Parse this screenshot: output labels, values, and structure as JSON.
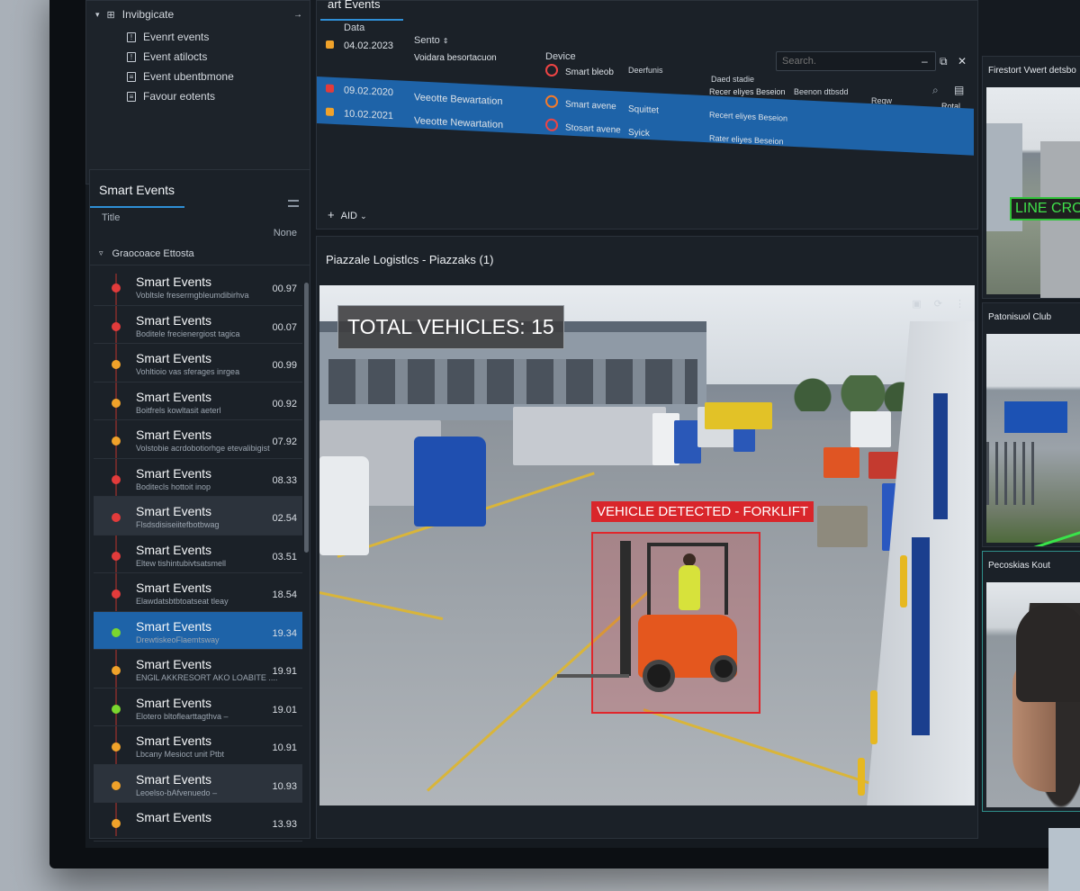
{
  "nav": {
    "header": "Invibgicate",
    "items": [
      "Evenrt events",
      "Event atilocts",
      "Event ubentbmone",
      "Favour eotents"
    ]
  },
  "events_panel": {
    "title": "Smart Events",
    "col_title": "Title",
    "col_none": "None",
    "group": "Graocoace Ettosta",
    "items": [
      {
        "name": "Smart Events",
        "sub": "Vobltsle fresermgbleumdibirhva",
        "time": "00.97",
        "color": "#e23b3b",
        "state": ""
      },
      {
        "name": "Smart Events",
        "sub": "Boditele frecienergiost tagica",
        "time": "00.07",
        "color": "#e23b3b",
        "state": ""
      },
      {
        "name": "Smart Events",
        "sub": "Vohltioio vas sferages inrgea",
        "time": "00.99",
        "color": "#f0a22a",
        "state": ""
      },
      {
        "name": "Smart Events",
        "sub": "Boitfrels kowltasit aeterl",
        "time": "00.92",
        "color": "#f0a22a",
        "state": ""
      },
      {
        "name": "Smart Events",
        "sub": "Volstobie acrdobotiorhge etevalibigist",
        "time": "07.92",
        "color": "#f0a22a",
        "state": ""
      },
      {
        "name": "Smart Events",
        "sub": "Boditecls hottoit inop",
        "time": "08.33",
        "color": "#e23b3b",
        "state": ""
      },
      {
        "name": "Smart Events",
        "sub": "Flsdsdisiseiitefbotbwag",
        "time": "02.54",
        "color": "#e23b3b",
        "state": "grey"
      },
      {
        "name": "Smart Events",
        "sub": "Eltew tishintubivtsatsmell",
        "time": "03.51",
        "color": "#e23b3b",
        "state": ""
      },
      {
        "name": "Smart Events",
        "sub": "Elawdatsbtbtoatseat tleay",
        "time": "18.54",
        "color": "#e23b3b",
        "state": ""
      },
      {
        "name": "Smart Events",
        "sub": "DrewtiskeoFlaemtsway",
        "time": "19.34",
        "color": "#7bd62e",
        "state": "blue"
      },
      {
        "name": "Smart Events",
        "sub": "ENGlL AKKRESORT AKO LOABITE ....",
        "time": "19.91",
        "color": "#f0a22a",
        "state": ""
      },
      {
        "name": "Smart Events",
        "sub": "Elotero bltoflearttagthva –",
        "time": "19.01",
        "color": "#7bd62e",
        "state": ""
      },
      {
        "name": "Smart Events",
        "sub": "Lbcany Mesioct unit Ptbt",
        "time": "10.91",
        "color": "#f0a22a",
        "state": ""
      },
      {
        "name": "Smart Events",
        "sub": "Leoelso-bAfvenuedo –",
        "time": "10.93",
        "color": "#f0a22a",
        "state": "grey"
      },
      {
        "name": "Smart Events",
        "sub": "",
        "time": "13.93",
        "color": "#f0a22a",
        "state": ""
      }
    ]
  },
  "table": {
    "tab": "art Events",
    "col_data": "Data",
    "col_sento": "Sento",
    "col_device": "Device",
    "col_deerfunis": "Deerfunis",
    "col_daed": "Daed stadie",
    "col_beenon": "Beenon dtbsdd",
    "col_reqw": "Reqw",
    "search_placeholder": "Search.",
    "rows": [
      {
        "date": "04.02.2023",
        "title": "Voidara besortacuon",
        "device": "Smart bleob",
        "detail": "",
        "status": "",
        "badge": "#f0a22a",
        "sel": false
      },
      {
        "date": "09.02.2020",
        "title": "Veeotte Bewartation",
        "device": "Smart avene",
        "detail": "Squittet",
        "status": "Recert eliyes Beseion",
        "badge": "#e23b3b",
        "sel": true
      },
      {
        "date": "10.02.2021",
        "title": "Veeotte Newartation",
        "device": "Stosart avene",
        "detail": "Syick",
        "status": "Rater eliyes Beseion",
        "badge": "#f0a22a",
        "sel": false
      }
    ],
    "row0_extra": "Recer eliyes Beseion",
    "rotal": "Rotal",
    "add_label": "AID"
  },
  "video": {
    "title": "Piazzale Logistlcs - Piazzaks (1)",
    "total": "TOTAL VEHICLES: 15",
    "detect": "VEHICLE DETECTED - FORKLIFT"
  },
  "cams": [
    {
      "title": "Firestort Vwert detsbo",
      "overlay": "LINE CROS"
    },
    {
      "title": "Patonisuol Club",
      "overlay": ""
    },
    {
      "title": "Pecoskias Kout",
      "overlay": ""
    }
  ],
  "colors": {
    "accent": "#2f8fd6",
    "selected": "#1e63a8",
    "alert": "#d9262b",
    "line_cross": "#31c23a"
  }
}
